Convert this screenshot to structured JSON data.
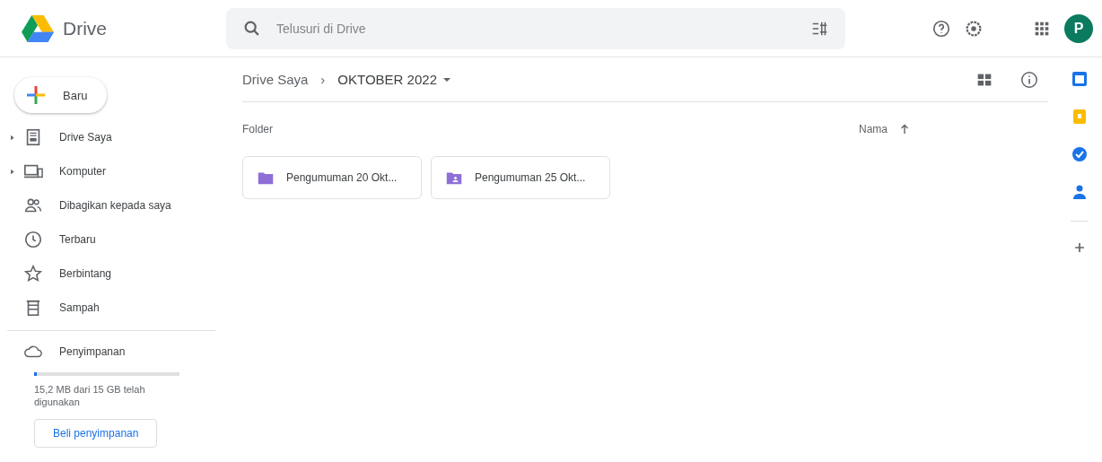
{
  "app": {
    "title": "Drive"
  },
  "search": {
    "placeholder": "Telusuri di Drive"
  },
  "avatar": {
    "initial": "P",
    "color": "#0b7a5e"
  },
  "new_button": {
    "label": "Baru"
  },
  "sidebar": {
    "items": [
      {
        "label": "Drive Saya",
        "kind": "drive",
        "expandable": true
      },
      {
        "label": "Komputer",
        "kind": "computer",
        "expandable": true
      },
      {
        "label": "Dibagikan kepada saya",
        "kind": "shared",
        "expandable": false
      },
      {
        "label": "Terbaru",
        "kind": "recent",
        "expandable": false
      },
      {
        "label": "Berbintang",
        "kind": "starred",
        "expandable": false
      },
      {
        "label": "Sampah",
        "kind": "trash",
        "expandable": false
      }
    ]
  },
  "storage": {
    "label": "Penyimpanan",
    "level": 0.02,
    "usage": "15,2 MB dari 15 GB telah digunakan",
    "buy": "Beli penyimpanan"
  },
  "breadcrumb": {
    "root": "Drive Saya",
    "separator": "›",
    "current": "OKTOBER 2022"
  },
  "section": {
    "title": "Folder",
    "sort": "Nama"
  },
  "folders": [
    {
      "name": "Pengumuman 20 Okt...",
      "shared": false
    },
    {
      "name": "Pengumuman 25 Okt...",
      "shared": true
    }
  ],
  "side_apps": [
    {
      "kind": "calendar",
      "color": "#1a73e8"
    },
    {
      "kind": "keep",
      "color": "#fbbc04"
    },
    {
      "kind": "tasks",
      "color": "#1a73e8"
    },
    {
      "kind": "contacts",
      "color": "#1a73e8"
    },
    {
      "kind": "add"
    }
  ]
}
